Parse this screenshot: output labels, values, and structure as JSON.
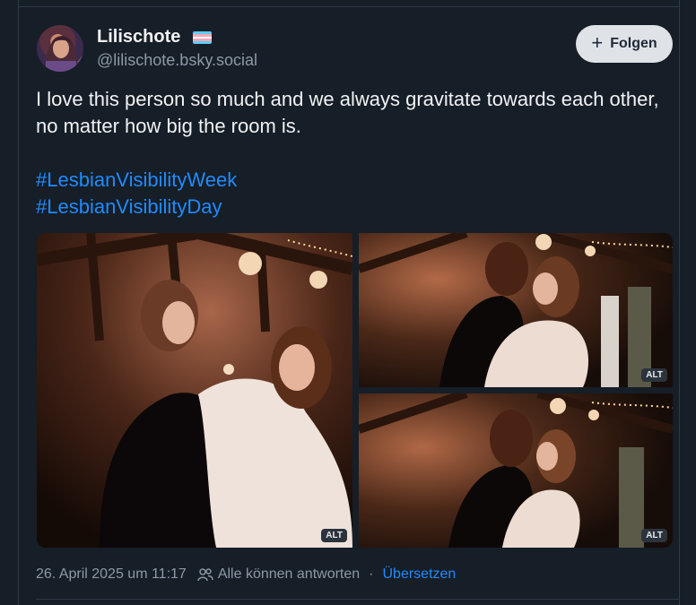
{
  "post": {
    "author_name": "Lilischote",
    "author_handle": "@lilischote.bsky.social",
    "follow_label": "Folgen",
    "text": "I love this person so much and we always gravitate towards each other, no matter how big the room is.",
    "hashtags": [
      "#LesbianVisibilityWeek",
      "#LesbianVisibilityDay"
    ],
    "images": [
      {
        "alt_badge": "ALT"
      },
      {
        "alt_badge": "ALT"
      },
      {
        "alt_badge": "ALT"
      }
    ],
    "timestamp": "26. April 2025 um 11:17",
    "reply_setting": "Alle können antworten",
    "separator": "·",
    "translate_label": "Übersetzen"
  },
  "icons": {
    "flag": "trans-flag-icon",
    "follow": "plus-icon",
    "reply": "people-icon"
  },
  "colors": {
    "background": "#161e27",
    "link": "#208bfe",
    "muted": "#8d99a6",
    "follow_bg": "#dfe3e8",
    "flag": [
      "#5bcefa",
      "#f5a9b8",
      "#ffffff",
      "#f5a9b8",
      "#5bcefa"
    ]
  }
}
